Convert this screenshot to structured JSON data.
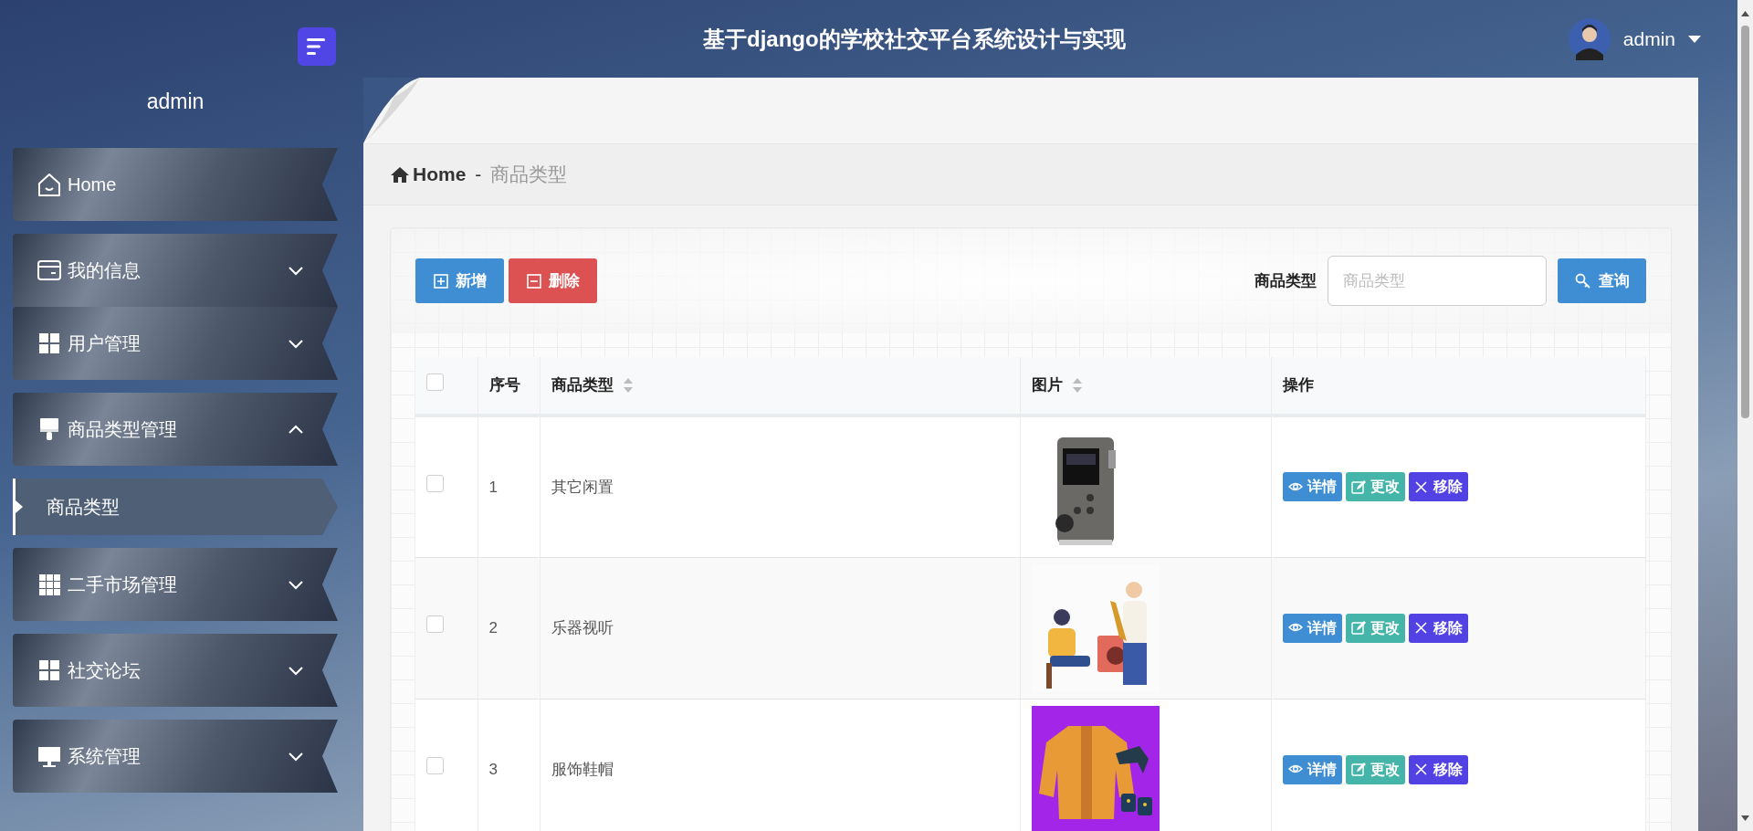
{
  "header": {
    "title": "基于django的学校社交平台系统设计与实现",
    "user": "admin"
  },
  "sidebar": {
    "username": "admin",
    "items": [
      {
        "label": "Home",
        "kind": "link"
      },
      {
        "label": "我的信息",
        "kind": "group",
        "expanded": false
      },
      {
        "label": "用户管理",
        "kind": "group",
        "expanded": false
      },
      {
        "label": "商品类型管理",
        "kind": "group",
        "expanded": true,
        "children": [
          {
            "label": "商品类型",
            "selected": true
          }
        ]
      },
      {
        "label": "二手市场管理",
        "kind": "group",
        "expanded": false
      },
      {
        "label": "社交论坛",
        "kind": "group",
        "expanded": false
      },
      {
        "label": "系统管理",
        "kind": "group",
        "expanded": false
      }
    ]
  },
  "breadcrumb": {
    "home": "Home",
    "separator": "-",
    "current": "商品类型"
  },
  "toolbar": {
    "buttons": [
      {
        "label": "新增",
        "kind": "add"
      },
      {
        "label": "删除",
        "kind": "delete"
      }
    ],
    "search": {
      "label": "商品类型",
      "placeholder": "商品类型",
      "button": "查询"
    }
  },
  "table": {
    "select_all_checked": false,
    "columns": [
      {
        "label": "序号",
        "sortable": false
      },
      {
        "label": "商品类型",
        "sortable": true
      },
      {
        "label": "图片",
        "sortable": true
      },
      {
        "label": "操作",
        "sortable": false
      }
    ],
    "rows": [
      {
        "checked": false,
        "index": "1",
        "category": "其它闲置",
        "image": {
          "kind": "picture"
        },
        "actions": [
          {
            "label": "详情",
            "kind": "view"
          },
          {
            "label": "更改",
            "kind": "edit"
          },
          {
            "label": "移除",
            "kind": "remove"
          }
        ]
      },
      {
        "checked": false,
        "index": "2",
        "category": "乐器视听",
        "image": {
          "kind": "picture"
        },
        "actions": [
          {
            "label": "详情",
            "kind": "view"
          },
          {
            "label": "更改",
            "kind": "edit"
          },
          {
            "label": "移除",
            "kind": "remove"
          }
        ]
      },
      {
        "checked": false,
        "index": "3",
        "category": "服饰鞋帽",
        "image": {
          "kind": "picture"
        },
        "actions": [
          {
            "label": "详情",
            "kind": "view"
          },
          {
            "label": "更改",
            "kind": "edit"
          },
          {
            "label": "移除",
            "kind": "remove"
          }
        ]
      }
    ]
  }
}
